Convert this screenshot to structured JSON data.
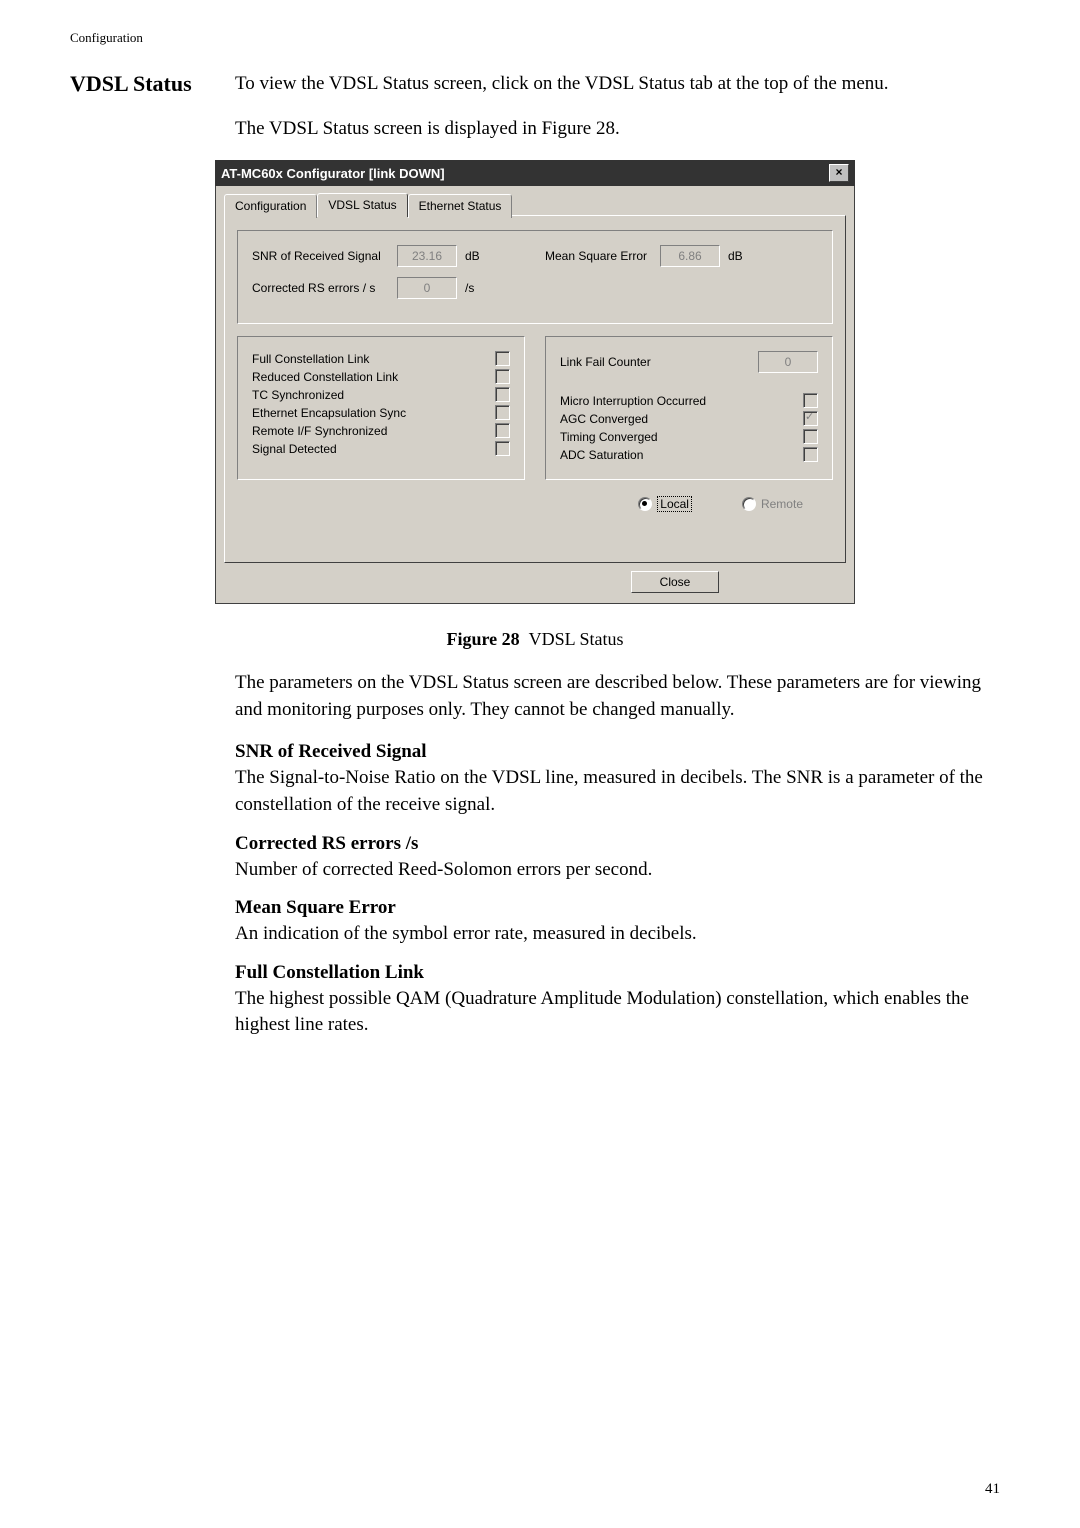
{
  "header": "Configuration",
  "section_title": "VDSL Status",
  "intro": "To view the VDSL Status screen, click on the VDSL Status tab at the top of the menu.",
  "intro2": "The VDSL Status screen is displayed in Figure 28.",
  "dialog": {
    "title": "AT-MC60x Configurator  [link DOWN]",
    "tabs": {
      "config": "Configuration",
      "vdsl": "VDSL Status",
      "eth": "Ethernet Status"
    },
    "snr_label": "SNR of Received Signal",
    "snr_value": "23.16",
    "snr_unit": "dB",
    "corrected_label": "Corrected RS errors / s",
    "corrected_value": "0",
    "corrected_unit": "/s",
    "mse_label": "Mean Square Error",
    "mse_value": "6.86",
    "mse_unit": "dB",
    "left_checks": {
      "full": "Full Constellation Link",
      "reduced": "Reduced Constellation Link",
      "tc": "TC Synchronized",
      "enc": "Ethernet Encapsulation Sync",
      "remote": "Remote I/F Synchronized",
      "signal": "Signal Detected"
    },
    "link_fail_label": "Link Fail Counter",
    "link_fail_value": "0",
    "right_checks": {
      "micro": "Micro Interruption Occurred",
      "agc": "AGC Converged",
      "timing": "Timing Converged",
      "adc": "ADC Saturation"
    },
    "radio_local": "Local",
    "radio_remote": "Remote",
    "close_btn": "Close"
  },
  "figure_label": "Figure 28",
  "figure_desc": "VDSL Status",
  "para1": "The parameters on the VDSL Status screen are described below. These parameters are for viewing and monitoring purposes only. They cannot be changed manually.",
  "h_snr": "SNR of Received Signal",
  "t_snr": "The Signal-to-Noise Ratio on the VDSL line, measured in decibels. The SNR is a parameter of the constellation of the receive signal.",
  "h_corr": "Corrected RS errors /s",
  "t_corr": "Number of corrected Reed-Solomon errors per second.",
  "h_mse": "Mean Square Error",
  "t_mse": "An indication of the symbol error rate, measured in decibels.",
  "h_full": "Full Constellation Link",
  "t_full": "The highest possible QAM (Quadrature Amplitude Modulation) constellation, which enables the highest line rates.",
  "page_num": "41"
}
